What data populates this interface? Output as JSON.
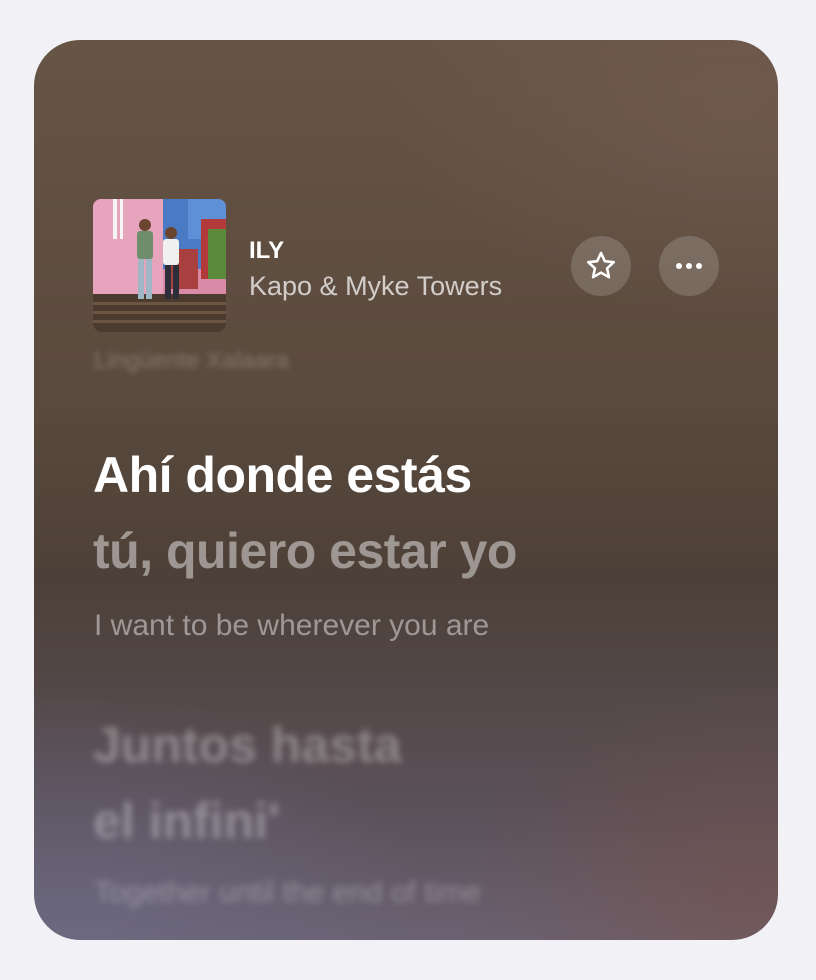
{
  "song": {
    "title": "ILY",
    "artist": "Kapo & Myke Towers",
    "artwork_icon": "album-artwork"
  },
  "actions": {
    "favorite_icon": "star-icon",
    "more_icon": "more-horizontal-icon"
  },
  "lyrics": {
    "previous_line": "Lingüente Xalaara",
    "current_line_1": "Ahí donde estás",
    "current_line_2": "tú, quiero estar yo",
    "current_translation": "I want to be wherever you are",
    "upcoming_line_1": "Juntos hasta",
    "upcoming_line_2": "el infini'",
    "upcoming_translation": "Together until the end of time"
  },
  "colors": {
    "background": "#f2f2f6",
    "card_top": "#665445",
    "card_bottom": "#6a6272",
    "text_primary": "#ffffff"
  }
}
